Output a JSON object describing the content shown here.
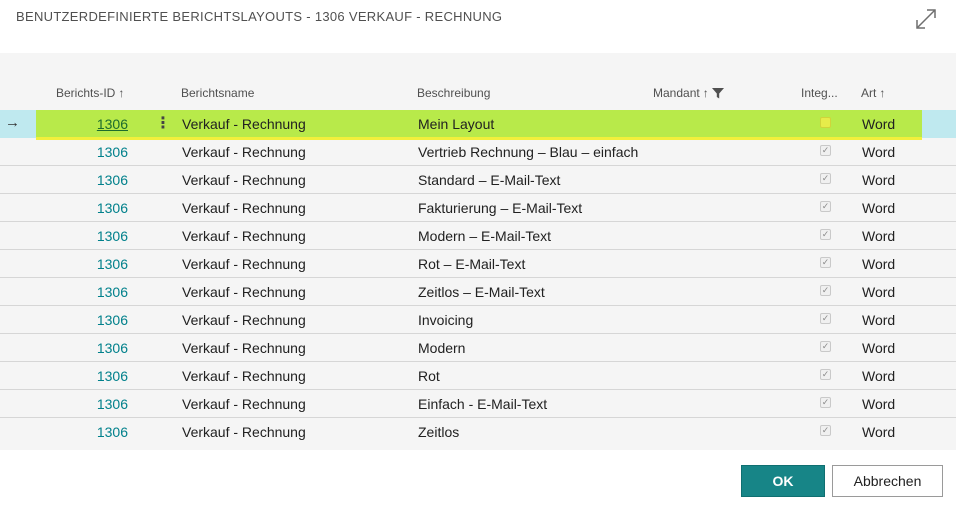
{
  "dialog": {
    "title": "BENUTZERDEFINIERTE BERICHTSLAYOUTS - 1306 VERKAUF - RECHNUNG"
  },
  "columns": {
    "id": "Berichts-ID",
    "name": "Berichtsname",
    "desc": "Beschreibung",
    "company": "Mandant",
    "integ": "Integ...",
    "art": "Art",
    "sort_glyph": "↑"
  },
  "rows": [
    {
      "id": "1306",
      "name": "Verkauf - Rechnung",
      "desc": "Mein Layout",
      "integrated": false,
      "art": "Word",
      "selected": true
    },
    {
      "id": "1306",
      "name": "Verkauf - Rechnung",
      "desc": "Vertrieb Rechnung – Blau – einfach",
      "integrated": true,
      "art": "Word"
    },
    {
      "id": "1306",
      "name": "Verkauf - Rechnung",
      "desc": "Standard – E-Mail-Text",
      "integrated": true,
      "art": "Word"
    },
    {
      "id": "1306",
      "name": "Verkauf - Rechnung",
      "desc": "Fakturierung – E-Mail-Text",
      "integrated": true,
      "art": "Word"
    },
    {
      "id": "1306",
      "name": "Verkauf - Rechnung",
      "desc": "Modern – E-Mail-Text",
      "integrated": true,
      "art": "Word"
    },
    {
      "id": "1306",
      "name": "Verkauf - Rechnung",
      "desc": "Rot – E-Mail-Text",
      "integrated": true,
      "art": "Word"
    },
    {
      "id": "1306",
      "name": "Verkauf - Rechnung",
      "desc": "Zeitlos – E-Mail-Text",
      "integrated": true,
      "art": "Word"
    },
    {
      "id": "1306",
      "name": "Verkauf - Rechnung",
      "desc": "Invoicing",
      "integrated": true,
      "art": "Word"
    },
    {
      "id": "1306",
      "name": "Verkauf - Rechnung",
      "desc": "Modern",
      "integrated": true,
      "art": "Word"
    },
    {
      "id": "1306",
      "name": "Verkauf - Rechnung",
      "desc": "Rot",
      "integrated": true,
      "art": "Word"
    },
    {
      "id": "1306",
      "name": "Verkauf - Rechnung",
      "desc": "Einfach - E-Mail-Text",
      "integrated": true,
      "art": "Word"
    },
    {
      "id": "1306",
      "name": "Verkauf - Rechnung",
      "desc": "Zeitlos",
      "integrated": true,
      "art": "Word"
    }
  ],
  "buttons": {
    "ok": "OK",
    "cancel": "Abbrechen"
  },
  "colors": {
    "accent": "#178587",
    "link": "#00808b",
    "selection_band": "#b8ea4a",
    "selection_row": "#bfe9ef"
  },
  "icons": {
    "expand": "expand-icon",
    "filter": "filter-icon",
    "row_arrow": "arrow-right-icon",
    "row_menu": "more-vertical-icon"
  }
}
